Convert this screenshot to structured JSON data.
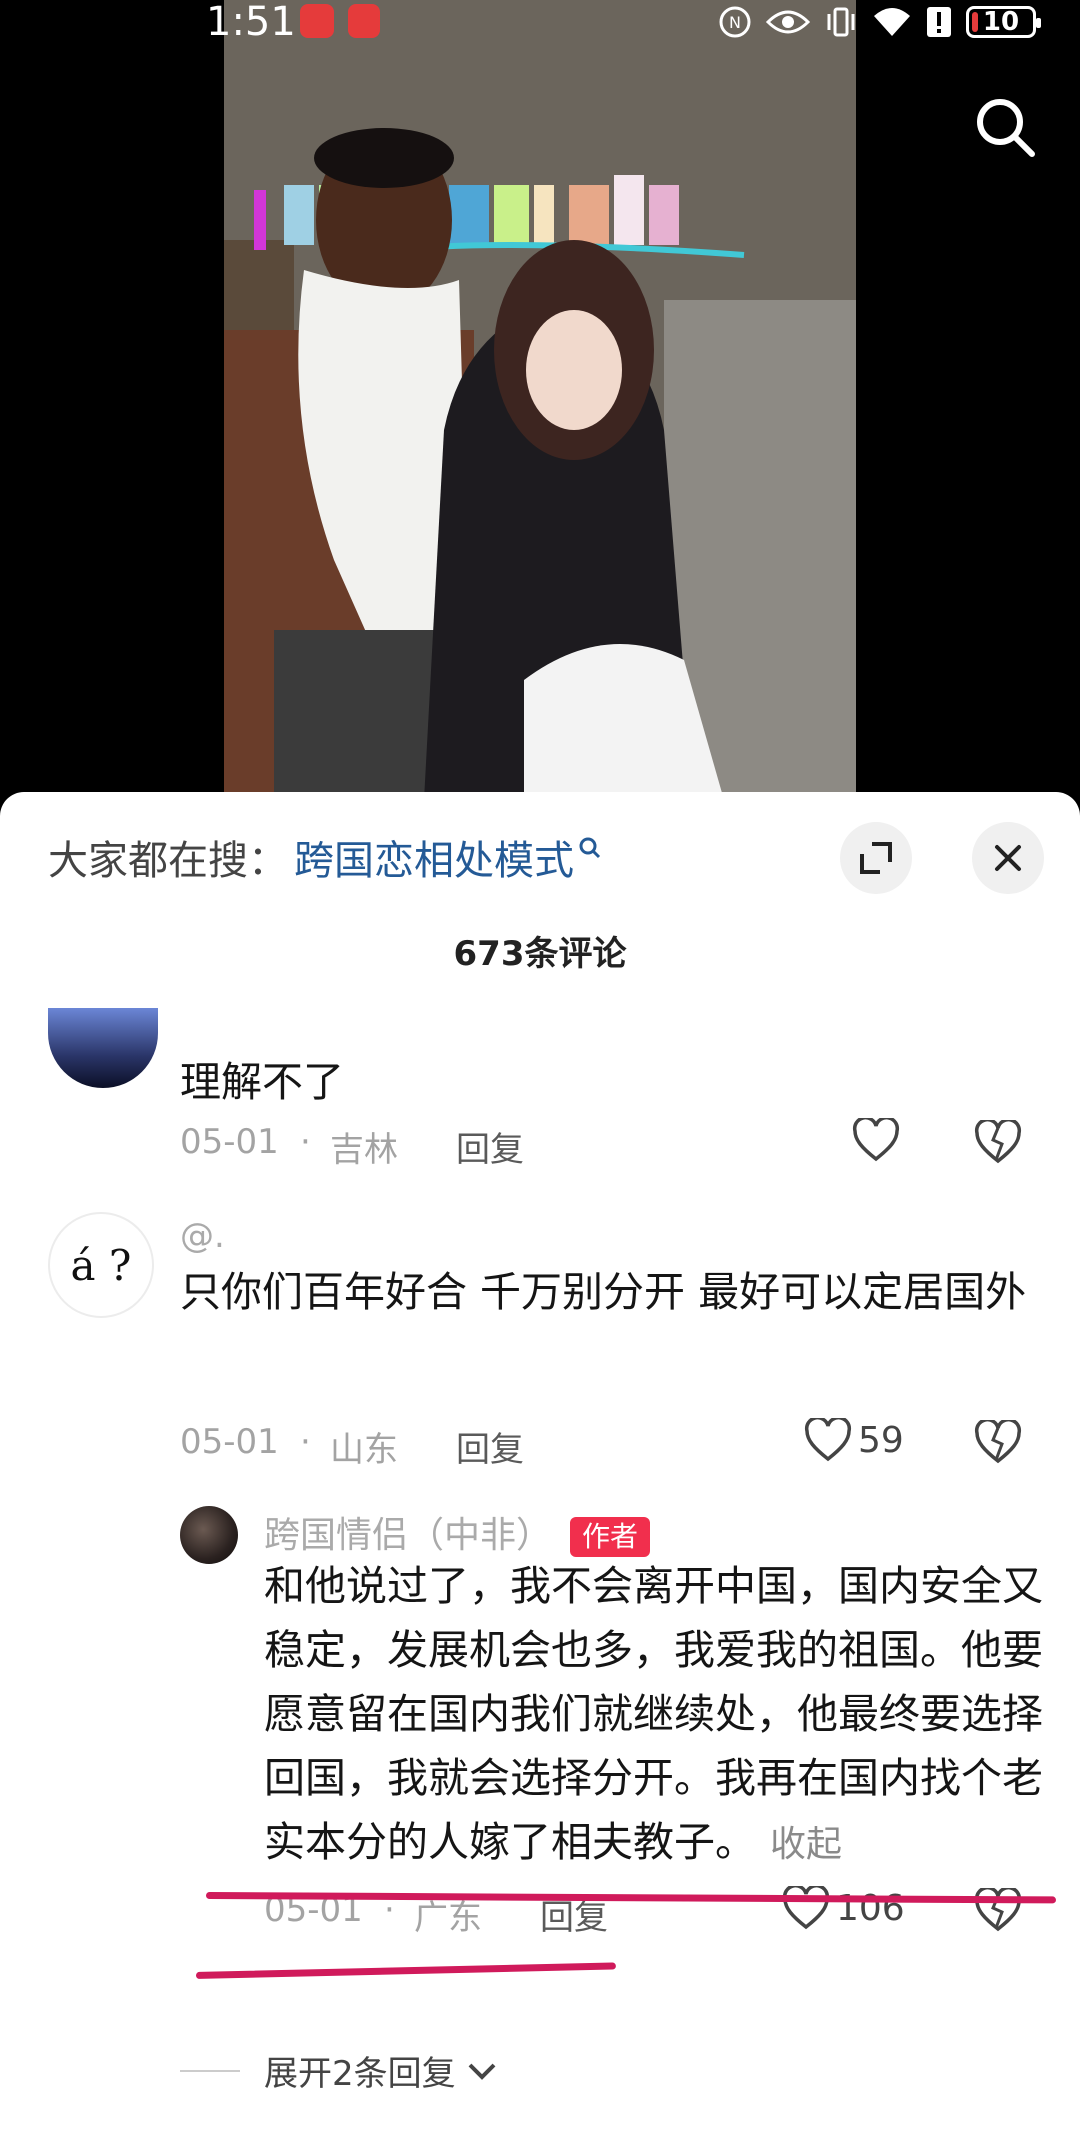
{
  "status_bar": {
    "time": "1:51",
    "battery_level": "10",
    "colors": {
      "app_icon": "#e53b3b",
      "battery": "#e53b3b"
    }
  },
  "video": {
    "search_icon": "search-icon"
  },
  "sheet": {
    "search_hint_label": "大家都在搜：",
    "search_hint_term": "跨国恋相处模式",
    "comment_count": "673条评论",
    "expand_icon": "expand-icon",
    "close_icon": "close-icon"
  },
  "comments": [
    {
      "text": "理解不了",
      "date": "05-01",
      "location": "吉林",
      "reply_label": "回复",
      "likes": ""
    },
    {
      "avatar_text": "á ?",
      "username": "@.",
      "text": "只你们百年好合 千万别分开 最好可以定居国外",
      "date": "05-01",
      "location": "山东",
      "reply_label": "回复",
      "likes": "59"
    }
  ],
  "reply": {
    "username": "跨国情侣（中非）",
    "author_tag": "作者",
    "text": "和他说过了，我不会离开中国，国内安全又稳定，发展机会也多，我爱我的祖国。他要愿意留在国内我们就继续处，他最终要选择回国，我就会选择分开。我再在国内找个老实本分的人嫁了相夫教子。",
    "collapse_label": "收起",
    "date": "05-01",
    "location": "广东",
    "reply_label": "回复",
    "likes": "106"
  },
  "expand_replies_label": "展开2条回复",
  "colors": {
    "accent_link": "#245a96",
    "author_tag": "#f12f4d",
    "annotation_line": "#d01a5b"
  }
}
